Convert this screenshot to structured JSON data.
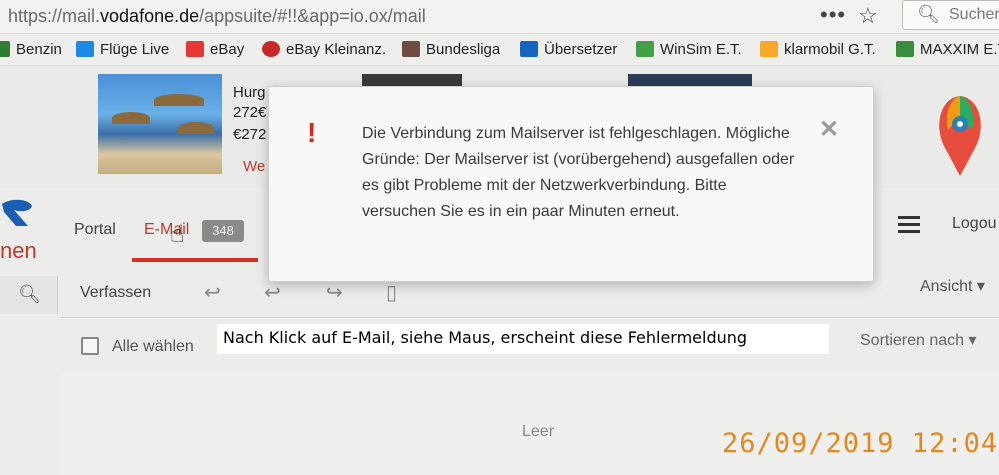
{
  "browser": {
    "url_prefix": "https://mail.",
    "url_domain": "vodafone.de",
    "url_suffix": "/appsuite/#!!&app=io.ox/mail",
    "menu_dots": "•••",
    "star": "☆",
    "search_placeholder": "Sucher"
  },
  "bookmarks": [
    {
      "label": "Benzin",
      "color": "#2e7d32"
    },
    {
      "label": "Flüge Live",
      "color": "#1e88e5"
    },
    {
      "label": "eBay",
      "color": "#e53935"
    },
    {
      "label": "eBay Kleinanz.",
      "color": "#c62828"
    },
    {
      "label": "Bundesliga",
      "color": "#6d4c41"
    },
    {
      "label": "Übersetzer",
      "color": "#1565c0"
    },
    {
      "label": "WinSim E.T.",
      "color": "#43a047"
    },
    {
      "label": "klarmobil G.T.",
      "color": "#f9a825"
    },
    {
      "label": "MAXXIM E.T.",
      "color": "#388e3c"
    }
  ],
  "ad": {
    "title": "Hurg",
    "price1": "272€",
    "price2": "€272",
    "link": "We"
  },
  "nav": {
    "brand_text": "nen",
    "portal": "Portal",
    "email": "E-Mail",
    "unread_count": "348",
    "logout": "Logou"
  },
  "toolbar": {
    "compose": "Verfassen",
    "view": "Ansicht ▾"
  },
  "list": {
    "select_all": "Alle wählen",
    "sort": "Sortieren nach ▾",
    "empty": "Leer"
  },
  "annotation": "Nach Klick auf E-Mail, siehe Maus, erscheint diese Fehlermeldung",
  "timestamp": "26/09/2019  12:04",
  "dialog": {
    "icon": "!",
    "message": "Die Verbindung zum Mailserver ist fehlgeschlagen. Mögliche Gründe: Der Mailserver ist (vorübergehend) ausgefallen oder es gibt Probleme mit der Netzwerkverbindung. Bitte versuchen Sie es in ein paar Minuten erneut.",
    "close": "✕"
  }
}
